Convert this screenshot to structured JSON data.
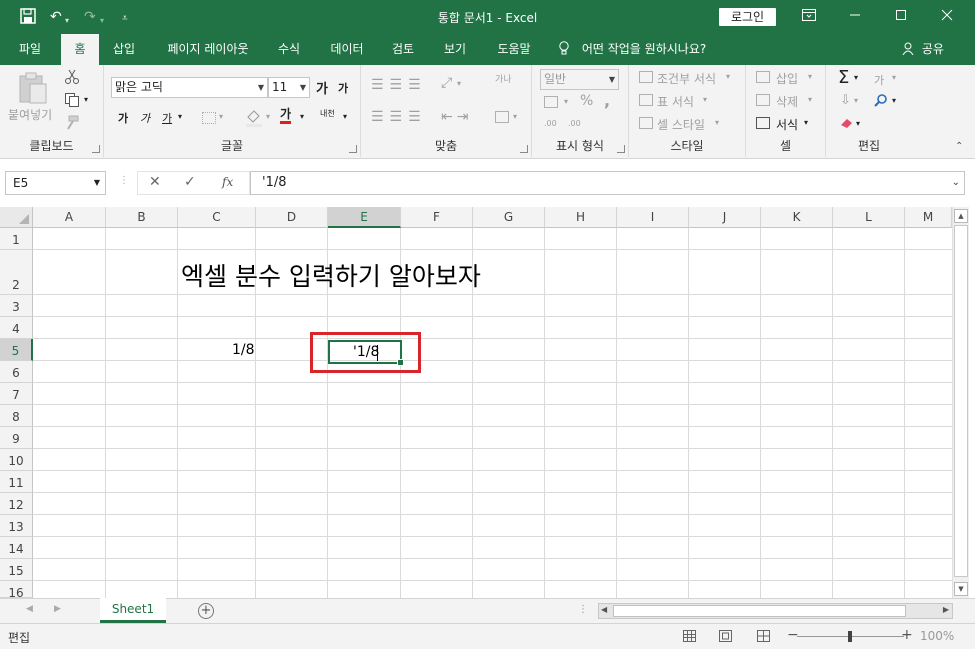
{
  "window": {
    "title": "통합 문서1  -  Excel",
    "login_label": "로그인"
  },
  "menu": {
    "tabs": [
      "파일",
      "홈",
      "삽입",
      "페이지 레이아웃",
      "수식",
      "데이터",
      "검토",
      "보기",
      "도움말"
    ],
    "active_tab": "홈",
    "tell_me": "어떤 작업을 원하시나요?",
    "share": "공유"
  },
  "ribbon": {
    "clipboard": {
      "label": "클립보드",
      "paste": "붙여넣기"
    },
    "font": {
      "label": "글꼴",
      "font_name": "맑은 고딕",
      "font_size": "11",
      "grow": "가",
      "shrink": "가",
      "bold": "가",
      "italic": "가",
      "underline": "가",
      "font_color": "가",
      "phonetic": "내천"
    },
    "alignment": {
      "label": "맞춤",
      "wrap": "가나"
    },
    "number": {
      "label": "표시 형식",
      "format": "일반",
      "percent": "%",
      "comma": ",",
      "inc_decimal": ".00",
      "dec_decimal": ".00"
    },
    "styles": {
      "label": "스타일",
      "conditional": "조건부 서식",
      "table": "표 서식",
      "cell_styles": "셀 스타일"
    },
    "cells": {
      "label": "셀",
      "insert": "삽입",
      "delete": "삭제",
      "format": "서식"
    },
    "editing": {
      "label": "편집",
      "sort": "가"
    }
  },
  "formula_bar": {
    "name_box": "E5",
    "fx": "fx",
    "content": "'1/8"
  },
  "grid": {
    "columns": [
      "A",
      "B",
      "C",
      "D",
      "E",
      "F",
      "G",
      "H",
      "I",
      "J",
      "K",
      "L",
      "M"
    ],
    "rows": [
      "1",
      "2",
      "3",
      "4",
      "5",
      "6",
      "7",
      "8",
      "9",
      "10",
      "11",
      "12",
      "13",
      "14",
      "15",
      "16"
    ],
    "selected_column": "E",
    "selected_row": "5",
    "title_text": "엑셀 분수 입력하기 알아보자",
    "c5": "1/8",
    "e5": "'1/8"
  },
  "sheets": {
    "tabs": [
      "Sheet1"
    ],
    "add": "+"
  },
  "status": {
    "mode": "편집",
    "zoom": "100%",
    "zoom_minus": "−",
    "zoom_plus": "+"
  },
  "colors": {
    "brand": "#217346",
    "highlight": "#d9252a"
  }
}
